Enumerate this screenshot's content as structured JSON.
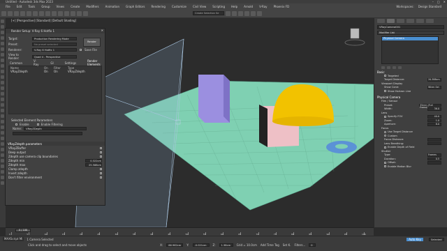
{
  "window": {
    "title": "Untitled - Autodesk 3ds Max 2023"
  },
  "menu": {
    "items": [
      "File",
      "Edit",
      "Tools",
      "Group",
      "Views",
      "Create",
      "Modifiers",
      "Animation",
      "Graph Editors",
      "Rendering",
      "Customize",
      "Civil View",
      "Scripting",
      "Help",
      "Arnold",
      "V-Ray",
      "Phoenix FD"
    ],
    "workspace_label": "Workspaces:",
    "workspace_value": "Design Standard"
  },
  "toolbar": {
    "selection_set_placeholder": "Create Selection Se"
  },
  "viewport": {
    "label": "[+] [Perspective] [Standard] [Default Shading]"
  },
  "render_setup": {
    "title": "Render Setup: V-Ray 6 Hotfix 1",
    "target_label": "Target:",
    "target_value": "Production Rendering Mode",
    "preset_label": "Preset:",
    "preset_value": "No preset selected",
    "renderer_label": "Renderer:",
    "renderer_value": "V-Ray 6 Hotfix 1",
    "save_file_label": "Save File",
    "view_label": "View to Render:",
    "view_value": "Quad 4 - Perspective",
    "render_button": "Render",
    "tabs": [
      "Common",
      "V-Ray",
      "GI",
      "Settings",
      "Render Elements"
    ],
    "list_headers": [
      "Name",
      "On",
      "Filter",
      "Type"
    ],
    "list_rows": [
      {
        "name": "VRayZdepth",
        "on": "On",
        "filter": "On",
        "type": "VRayZdepth"
      }
    ],
    "selected_params_label": "Selected Element Parameters",
    "enable_label": "Enable",
    "enable_filtering_label": "Enable Filtering",
    "name_label": "Name:",
    "name_value": "VRayZDepth",
    "params_title": "VRayZdepth parameters",
    "params": [
      {
        "label": "VRayZBuffer",
        "value": ""
      },
      {
        "label": "Deep output",
        "value": ""
      },
      {
        "label": "Zdepth use camera clip boundaries",
        "value": ""
      },
      {
        "label": "Zdepth min",
        "value": "0.322cm"
      },
      {
        "label": "Zdepth max",
        "value": "25.588cm"
      },
      {
        "label": "Clamp zdepth",
        "value": ""
      },
      {
        "label": "Invert zdepth",
        "value": ""
      },
      {
        "label": "Don't filter environment",
        "value": ""
      }
    ]
  },
  "command_panel": {
    "object_name": "VRayCamera001",
    "modifier_list_label": "Modifier List",
    "stack_item": "Physical Camera",
    "basic_label": "Basic",
    "targeted_label": "Targeted",
    "target_distance_label": "Target Distance:",
    "target_distance_value": "20.388cm",
    "viewport_display_label": "Viewport Display",
    "show_cone_label": "Show Cone:",
    "show_cone_value": "When Sel",
    "show_horizon_label": "Show Horizon Line",
    "physical_camera_label": "Physical Camera",
    "film_label": "Film / Sensor",
    "preset_label": "Preset:",
    "preset_value": "35mm (Full Frame)",
    "width_label": "Width:",
    "width_value": "36.0",
    "lens_label": "Lens",
    "focal_label": "Specify FOV",
    "focal_value": "40.0",
    "zoom_label": "Zoom:",
    "zoom_value": "1.0",
    "aperture_label": "Aperture:",
    "aperture_value": "8.0",
    "focus_label": "Focus",
    "use_target_label": "Use Target Distance",
    "custom_label": "Custom",
    "focus_distance_label": "Focus Distance:",
    "lens_breathing_label": "Lens Breathing:",
    "enable_dof_label": "Enable Depth of Field",
    "shutter_label": "Shutter",
    "type_label": "Type:",
    "type_value": "Frames",
    "duration_label": "Duration:",
    "duration_value": "0.5",
    "offset_label": "Offset:",
    "enable_mblur_label": "Enable Motion Blur"
  },
  "timeline": {
    "frame_display": "0 / 100",
    "ticks": [
      "0",
      "5",
      "10",
      "15",
      "20",
      "25",
      "30",
      "35",
      "40",
      "45",
      "50",
      "55",
      "60",
      "65",
      "70",
      "75",
      "80",
      "85",
      "90",
      "95",
      "100"
    ]
  },
  "status": {
    "selection": "1 Camera Selected",
    "prompt": "Click and drag to select and move objects",
    "x_label": "X:",
    "x_value": "86.962cm",
    "y_label": "Y:",
    "y_value": "-0.021cm",
    "z_label": "Z:",
    "z_value": "1.38cm",
    "grid": "Grid = 10.0cm",
    "add_time_tag": "Add Time Tag",
    "autokey": "Auto Key",
    "selected": "Selected",
    "set_key": "Set K.",
    "filters": "Filters...",
    "frame": "0",
    "script_label": "MAXScript Mi"
  }
}
